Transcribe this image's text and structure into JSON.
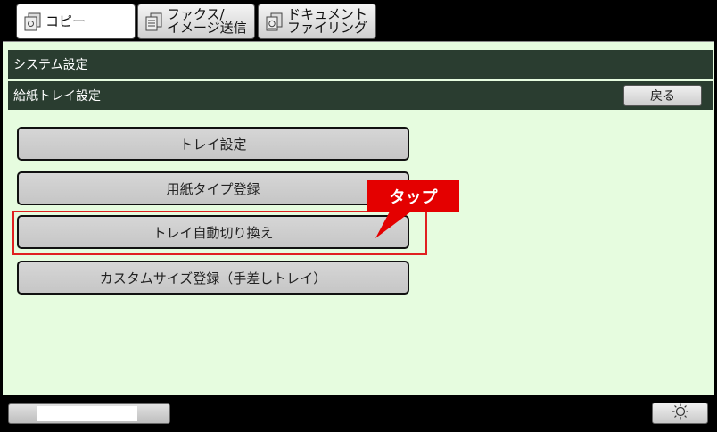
{
  "tabs": [
    {
      "label": "コピー",
      "icon": "copy-icon"
    },
    {
      "label": "ファクス/\nイメージ送信",
      "icon": "fax-icon"
    },
    {
      "label": "ドキュメント\nファイリング",
      "icon": "document-filing-icon"
    }
  ],
  "breadcrumb": {
    "level1": "システム設定",
    "level2": "給紙トレイ設定",
    "back_label": "戻る"
  },
  "menu": [
    {
      "label": "トレイ設定"
    },
    {
      "label": "用紙タイプ登録"
    },
    {
      "label": "トレイ自動切り換え"
    },
    {
      "label": "カスタムサイズ登録（手差しトレイ）"
    }
  ],
  "callout": {
    "label": "タップ"
  },
  "colors": {
    "panel_bg": "#e6fcdf",
    "header_bar": "#2a3d30",
    "highlight": "#e02020",
    "callout_bg": "#e40000"
  },
  "bottom": {
    "brightness_icon": "brightness-icon"
  }
}
